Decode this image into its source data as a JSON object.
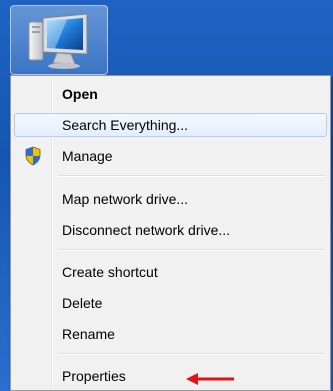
{
  "desktop": {
    "icon": "computer-icon"
  },
  "menu": {
    "items": [
      {
        "label": "Open",
        "bold": true
      },
      {
        "label": "Search Everything...",
        "hover": true
      },
      {
        "label": "Manage",
        "icon": "uac-shield-icon"
      },
      {
        "label": "Map network drive..."
      },
      {
        "label": "Disconnect network drive..."
      },
      {
        "label": "Create shortcut"
      },
      {
        "label": "Delete"
      },
      {
        "label": "Rename"
      },
      {
        "label": "Properties",
        "annotation": "red-arrow-icon"
      }
    ]
  },
  "colors": {
    "desktop": "#1a5bb4",
    "menu_bg": "#f1f1f1",
    "hover_border": "#aecff7",
    "annotation_arrow": "#e0141b"
  }
}
